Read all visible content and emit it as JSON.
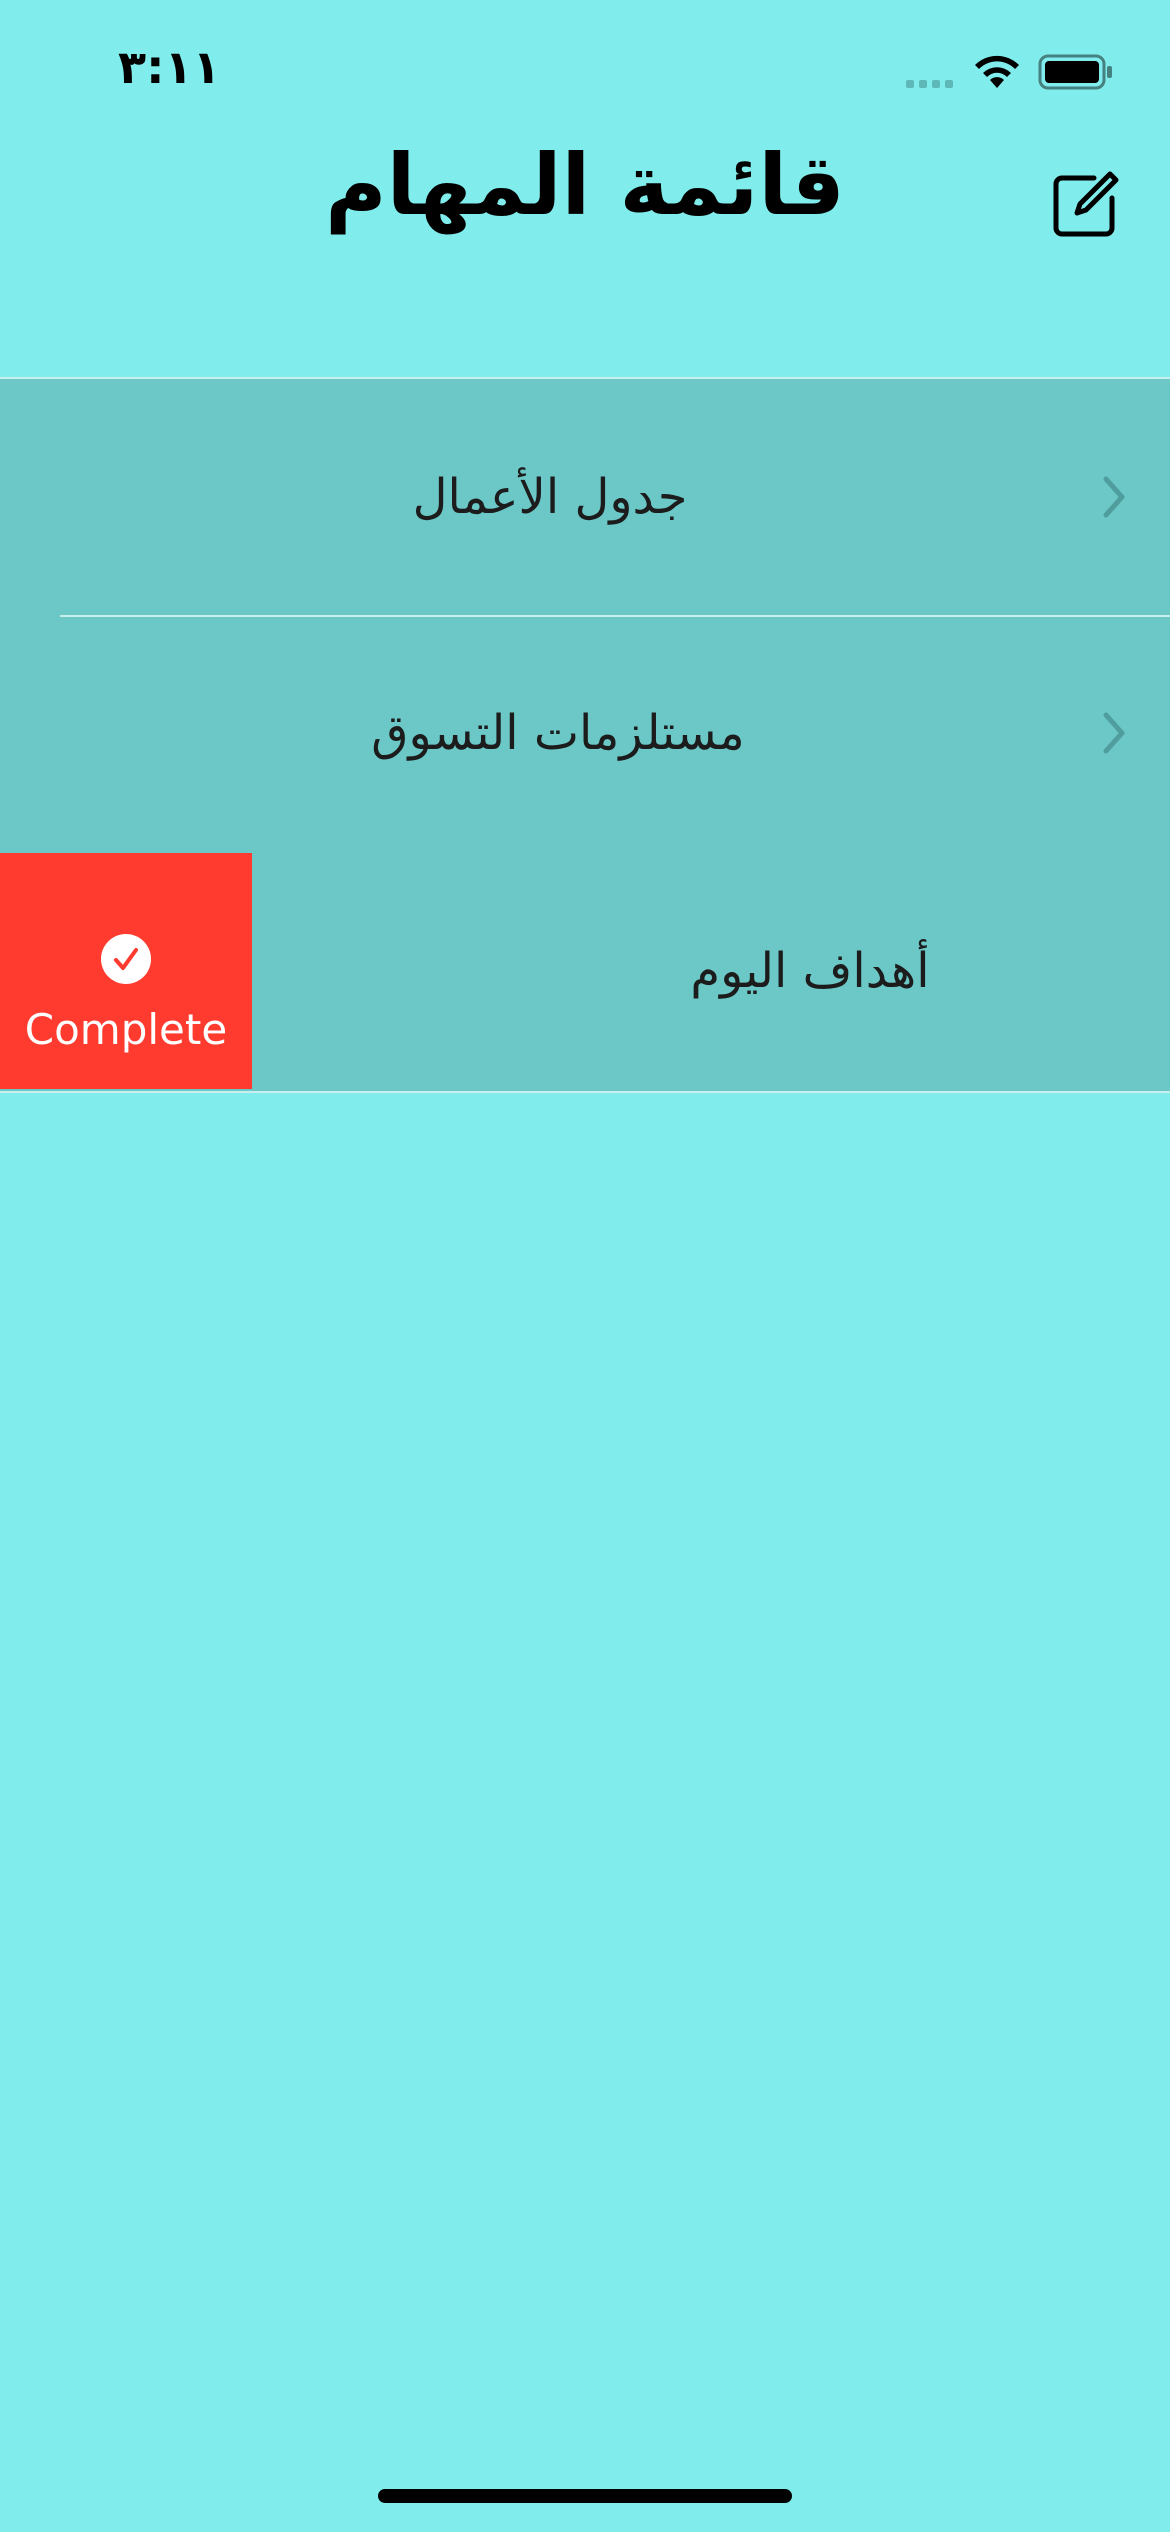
{
  "status_bar": {
    "time": "٣:١١"
  },
  "nav": {
    "title": "قائمة المهام",
    "compose_icon": "compose-icon"
  },
  "lists": [
    {
      "label": "جدول الأعمال",
      "icon": "chevron-right-icon"
    },
    {
      "label": "مستلزمات التسوق",
      "icon": "chevron-right-icon"
    },
    {
      "label": "أهداف اليوم",
      "icon": "chevron-right-icon"
    }
  ],
  "swipe_action": {
    "label": "Complete",
    "icon": "checkmark-circle-icon",
    "color": "#ff3b30"
  },
  "colors": {
    "background": "#80ecec",
    "cell": "#6cc7c7"
  }
}
